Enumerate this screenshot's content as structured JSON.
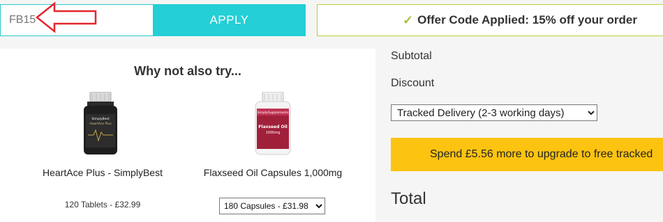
{
  "coupon": {
    "value": "FB15",
    "apply_label": "APPLY"
  },
  "offer": {
    "check_glyph": "✓",
    "text": "Offer Code Applied: 15% off your order"
  },
  "recommendations": {
    "title": "Why not also try...",
    "products": [
      {
        "name": "HeartAce Plus - SimplyBest",
        "price_text": "120 Tablets - £32.99",
        "label_brand": "SimplyBest",
        "label_product": "HeartAce Plus"
      },
      {
        "name": "Flaxseed Oil Capsules 1,000mg",
        "variant_selected": "180 Capsules - £31.98",
        "label_brand": "SimplySupplements",
        "label_product": "Flaxseed Oil",
        "label_dose": "1000mg"
      }
    ]
  },
  "summary": {
    "subtotal_label": "Subtotal",
    "discount_label": "Discount",
    "delivery_selected": "Tracked Delivery (2-3 working days)",
    "upgrade_text": "Spend £5.56 more to upgrade to free tracked",
    "total_label": "Total"
  },
  "colors": {
    "accent_teal": "#24cfd5",
    "offer_border": "#b7d13a",
    "check_green": "#a5c535",
    "banner_yellow": "#fdc311",
    "annotation_red": "#e3262c"
  }
}
